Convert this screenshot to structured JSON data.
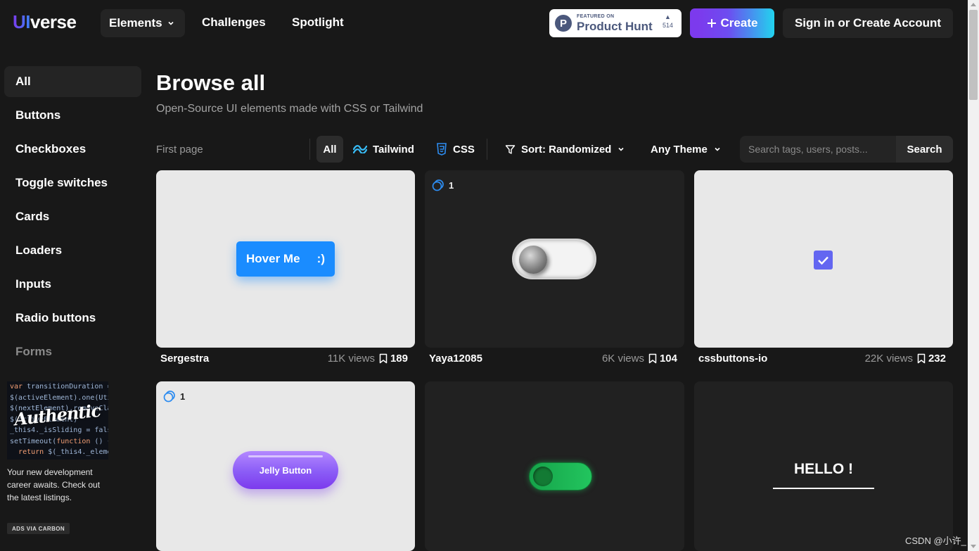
{
  "header": {
    "logo": {
      "ui": "UI",
      "rest": "verse"
    },
    "nav": {
      "elements": "Elements",
      "challenges": "Challenges",
      "spotlight": "Spotlight"
    },
    "product_hunt": {
      "featured": "FEATURED ON",
      "name": "Product Hunt",
      "count": "514"
    },
    "create": "Create",
    "signin": "Sign in or Create Account"
  },
  "sidebar": {
    "items": [
      "All",
      "Buttons",
      "Checkboxes",
      "Toggle switches",
      "Cards",
      "Loaders",
      "Inputs",
      "Radio buttons",
      "Forms"
    ],
    "active": "All",
    "ad": {
      "headline": "Authentic",
      "text": "Your new development career awaits. Check out the latest listings.",
      "badge": "ADS VIA CARBON"
    }
  },
  "main": {
    "title": "Browse all",
    "subtitle": "Open-Source UI elements made with CSS or Tailwind",
    "filters": {
      "first_page": "First page",
      "all": "All",
      "tailwind": "Tailwind",
      "css": "CSS",
      "sort": "Sort: Randomized",
      "theme": "Any Theme",
      "search_placeholder": "Search tags, users, posts...",
      "search_button": "Search"
    },
    "cards": [
      {
        "author": "Sergestra",
        "views": "11K views",
        "saves": "189",
        "preview_text": "Hover Me",
        "preview_smiley": ":)"
      },
      {
        "author": "Yaya12085",
        "views": "6K views",
        "saves": "104",
        "variants": "1"
      },
      {
        "author": "cssbuttons-io",
        "views": "22K views",
        "saves": "232"
      },
      {
        "variants": "1",
        "preview_text": "Jelly Button"
      },
      {},
      {
        "preview_text": "HELLO !"
      }
    ]
  },
  "watermark": "CSDN @小许_",
  "colors": {
    "accent_purple": "#7c3aed",
    "accent_cyan": "#22d3ee",
    "checkbox": "#6366f1",
    "hover_button": "#1a8cff"
  }
}
